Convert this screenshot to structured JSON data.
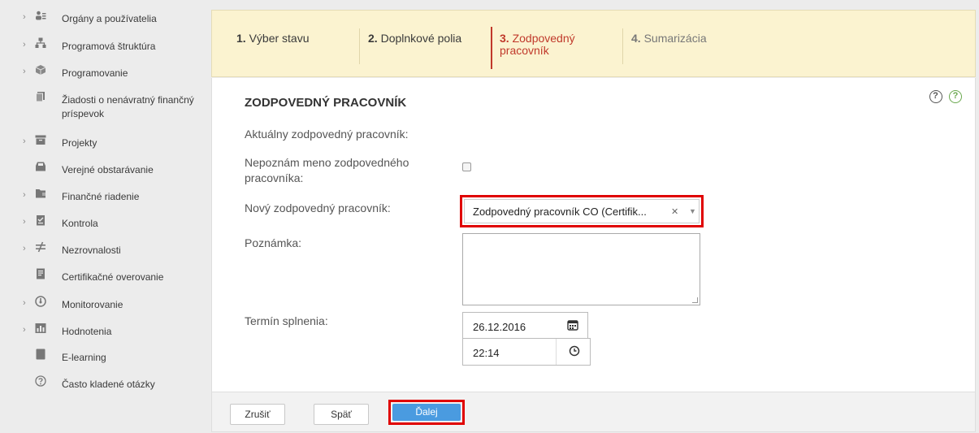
{
  "sidebar": {
    "items": [
      {
        "label": "Orgány a používatelia",
        "icon": "users-icon",
        "expandable": true
      },
      {
        "label": "Programová štruktúra",
        "icon": "hierarchy-icon",
        "expandable": true
      },
      {
        "label": "Programovanie",
        "icon": "box-icon",
        "expandable": true
      },
      {
        "label": "Žiadosti o nenávratný finančný príspevok",
        "icon": "document-copy-icon",
        "expandable": false
      },
      {
        "label": "Projekty",
        "icon": "archive-icon",
        "expandable": true
      },
      {
        "label": "Verejné obstarávanie",
        "icon": "tray-icon",
        "expandable": false
      },
      {
        "label": "Finančné riadenie",
        "icon": "folder-icon",
        "expandable": true
      },
      {
        "label": "Kontrola",
        "icon": "checklist-icon",
        "expandable": true
      },
      {
        "label": "Nezrovnalosti",
        "icon": "not-equal-icon",
        "expandable": true
      },
      {
        "label": "Certifikačné overovanie",
        "icon": "certificate-icon",
        "expandable": false
      },
      {
        "label": "Monitorovanie",
        "icon": "gauge-icon",
        "expandable": true
      },
      {
        "label": "Hodnotenia",
        "icon": "bar-chart-icon",
        "expandable": true
      },
      {
        "label": "E-learning",
        "icon": "book-icon",
        "expandable": false
      },
      {
        "label": "Často kladené otázky",
        "icon": "question-icon",
        "expandable": false
      }
    ]
  },
  "wizard": {
    "steps": [
      {
        "num": "1.",
        "label": "Výber stavu",
        "active": false
      },
      {
        "num": "2.",
        "label": "Doplnkové polia",
        "active": false
      },
      {
        "num": "3.",
        "label": "Zodpovedný pracovník",
        "active": true
      },
      {
        "num": "4.",
        "label": "Sumarizácia",
        "active": false
      }
    ]
  },
  "form": {
    "title": "ZODPOVEDNÝ PRACOVNÍK",
    "help_dark": "?",
    "help_green": "?",
    "current_label": "Aktuálny zodpovedný pracovník:",
    "unknown_label_1": "Nepoznám meno zodpovedného",
    "unknown_label_2": "pracovníka:",
    "unknown_checked": false,
    "new_label": "Nový zodpovedný pracovník:",
    "new_value": "Zodpovedný pracovník CO (Certifik...",
    "note_label": "Poznámka:",
    "note_value": "",
    "deadline_label": "Termín splnenia:",
    "date_value": "26.12.2016",
    "time_value": "22:14"
  },
  "footer": {
    "cancel_label": "Zrušiť",
    "back_label": "Späť",
    "next_label": "Ďalej"
  },
  "colors": {
    "wizard_bg": "#fbf3d0",
    "active_step": "#c0392b",
    "primary": "#4a9be0",
    "highlight": "#e00000"
  }
}
